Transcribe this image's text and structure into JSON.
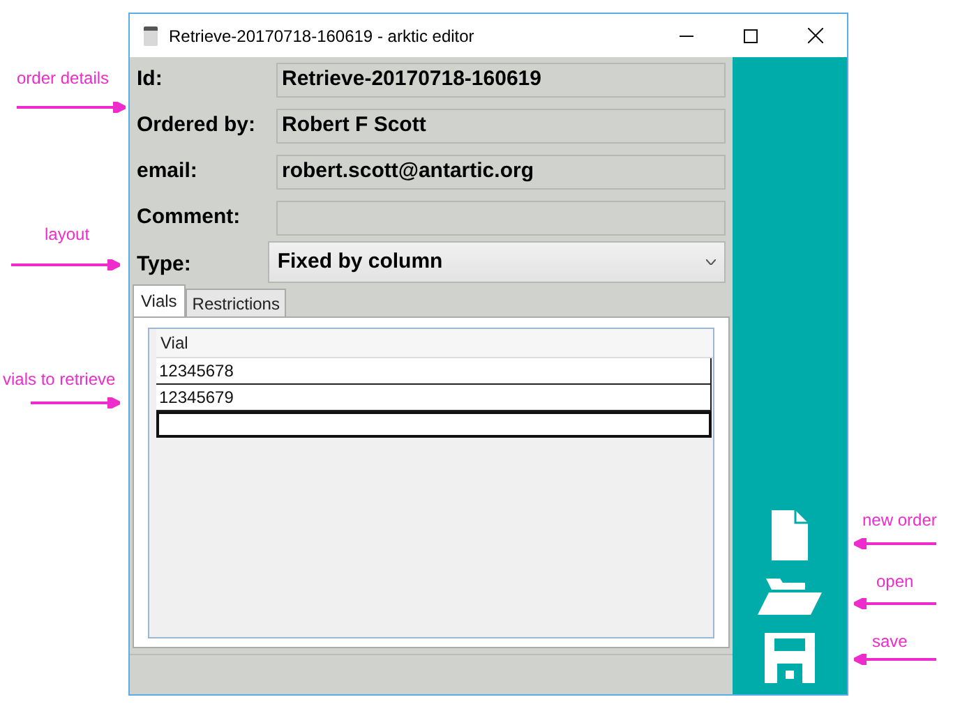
{
  "window": {
    "title": "Retrieve-20170718-160619 - arktic editor"
  },
  "fields": [
    {
      "label": "Id:",
      "value": "Retrieve-20170718-160619"
    },
    {
      "label": "Ordered by:",
      "value": "Robert F Scott"
    },
    {
      "label": "email:",
      "value": "robert.scott@antartic.org"
    },
    {
      "label": "Comment:"
    }
  ],
  "type_select": {
    "label": "Type:",
    "value": "Fixed by column"
  },
  "tabs": [
    {
      "label": "Vials",
      "selected": true
    },
    {
      "label": "Restrictions",
      "selected": false
    }
  ],
  "grid": {
    "columns": [
      "Vial"
    ],
    "rows": [
      "12345678",
      "12345679"
    ],
    "new_row_focused": true
  },
  "toolbar": [
    {
      "kind": "new"
    },
    {
      "kind": "open"
    },
    {
      "kind": "save"
    }
  ],
  "annotations": [
    {
      "text": "order details",
      "kind": "left"
    },
    {
      "text": "layout",
      "kind": "left"
    },
    {
      "text": "vials to retrieve",
      "kind": "left"
    },
    {
      "text": "new order",
      "kind": "right"
    },
    {
      "text": "open",
      "kind": "right"
    },
    {
      "text": "save",
      "kind": "right"
    }
  ]
}
